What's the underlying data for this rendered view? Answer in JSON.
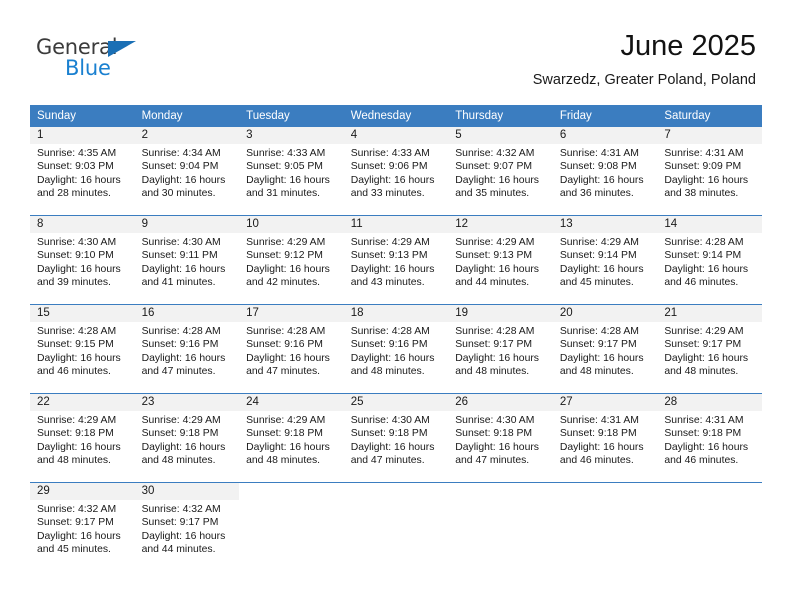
{
  "brand": {
    "name_top": "General",
    "name_bottom": "Blue",
    "triangle_icon": "blue-triangle-icon",
    "color_dark": "#3b3b3b",
    "color_blue": "#1a80d0"
  },
  "header": {
    "title": "June 2025",
    "subtitle": "Swarzedz, Greater Poland, Poland"
  },
  "theme": {
    "header_blue": "#3b7dc0",
    "daynum_bg": "#f2f2f2",
    "page_bg": "#ffffff"
  },
  "calendar": {
    "weekday_headers": [
      "Sunday",
      "Monday",
      "Tuesday",
      "Wednesday",
      "Thursday",
      "Friday",
      "Saturday"
    ],
    "weeks": [
      [
        {
          "day": "1",
          "lines": [
            "Sunrise: 4:35 AM",
            "Sunset: 9:03 PM",
            "Daylight: 16 hours",
            "and 28 minutes."
          ]
        },
        {
          "day": "2",
          "lines": [
            "Sunrise: 4:34 AM",
            "Sunset: 9:04 PM",
            "Daylight: 16 hours",
            "and 30 minutes."
          ]
        },
        {
          "day": "3",
          "lines": [
            "Sunrise: 4:33 AM",
            "Sunset: 9:05 PM",
            "Daylight: 16 hours",
            "and 31 minutes."
          ]
        },
        {
          "day": "4",
          "lines": [
            "Sunrise: 4:33 AM",
            "Sunset: 9:06 PM",
            "Daylight: 16 hours",
            "and 33 minutes."
          ]
        },
        {
          "day": "5",
          "lines": [
            "Sunrise: 4:32 AM",
            "Sunset: 9:07 PM",
            "Daylight: 16 hours",
            "and 35 minutes."
          ]
        },
        {
          "day": "6",
          "lines": [
            "Sunrise: 4:31 AM",
            "Sunset: 9:08 PM",
            "Daylight: 16 hours",
            "and 36 minutes."
          ]
        },
        {
          "day": "7",
          "lines": [
            "Sunrise: 4:31 AM",
            "Sunset: 9:09 PM",
            "Daylight: 16 hours",
            "and 38 minutes."
          ]
        }
      ],
      [
        {
          "day": "8",
          "lines": [
            "Sunrise: 4:30 AM",
            "Sunset: 9:10 PM",
            "Daylight: 16 hours",
            "and 39 minutes."
          ]
        },
        {
          "day": "9",
          "lines": [
            "Sunrise: 4:30 AM",
            "Sunset: 9:11 PM",
            "Daylight: 16 hours",
            "and 41 minutes."
          ]
        },
        {
          "day": "10",
          "lines": [
            "Sunrise: 4:29 AM",
            "Sunset: 9:12 PM",
            "Daylight: 16 hours",
            "and 42 minutes."
          ]
        },
        {
          "day": "11",
          "lines": [
            "Sunrise: 4:29 AM",
            "Sunset: 9:13 PM",
            "Daylight: 16 hours",
            "and 43 minutes."
          ]
        },
        {
          "day": "12",
          "lines": [
            "Sunrise: 4:29 AM",
            "Sunset: 9:13 PM",
            "Daylight: 16 hours",
            "and 44 minutes."
          ]
        },
        {
          "day": "13",
          "lines": [
            "Sunrise: 4:29 AM",
            "Sunset: 9:14 PM",
            "Daylight: 16 hours",
            "and 45 minutes."
          ]
        },
        {
          "day": "14",
          "lines": [
            "Sunrise: 4:28 AM",
            "Sunset: 9:14 PM",
            "Daylight: 16 hours",
            "and 46 minutes."
          ]
        }
      ],
      [
        {
          "day": "15",
          "lines": [
            "Sunrise: 4:28 AM",
            "Sunset: 9:15 PM",
            "Daylight: 16 hours",
            "and 46 minutes."
          ]
        },
        {
          "day": "16",
          "lines": [
            "Sunrise: 4:28 AM",
            "Sunset: 9:16 PM",
            "Daylight: 16 hours",
            "and 47 minutes."
          ]
        },
        {
          "day": "17",
          "lines": [
            "Sunrise: 4:28 AM",
            "Sunset: 9:16 PM",
            "Daylight: 16 hours",
            "and 47 minutes."
          ]
        },
        {
          "day": "18",
          "lines": [
            "Sunrise: 4:28 AM",
            "Sunset: 9:16 PM",
            "Daylight: 16 hours",
            "and 48 minutes."
          ]
        },
        {
          "day": "19",
          "lines": [
            "Sunrise: 4:28 AM",
            "Sunset: 9:17 PM",
            "Daylight: 16 hours",
            "and 48 minutes."
          ]
        },
        {
          "day": "20",
          "lines": [
            "Sunrise: 4:28 AM",
            "Sunset: 9:17 PM",
            "Daylight: 16 hours",
            "and 48 minutes."
          ]
        },
        {
          "day": "21",
          "lines": [
            "Sunrise: 4:29 AM",
            "Sunset: 9:17 PM",
            "Daylight: 16 hours",
            "and 48 minutes."
          ]
        }
      ],
      [
        {
          "day": "22",
          "lines": [
            "Sunrise: 4:29 AM",
            "Sunset: 9:18 PM",
            "Daylight: 16 hours",
            "and 48 minutes."
          ]
        },
        {
          "day": "23",
          "lines": [
            "Sunrise: 4:29 AM",
            "Sunset: 9:18 PM",
            "Daylight: 16 hours",
            "and 48 minutes."
          ]
        },
        {
          "day": "24",
          "lines": [
            "Sunrise: 4:29 AM",
            "Sunset: 9:18 PM",
            "Daylight: 16 hours",
            "and 48 minutes."
          ]
        },
        {
          "day": "25",
          "lines": [
            "Sunrise: 4:30 AM",
            "Sunset: 9:18 PM",
            "Daylight: 16 hours",
            "and 47 minutes."
          ]
        },
        {
          "day": "26",
          "lines": [
            "Sunrise: 4:30 AM",
            "Sunset: 9:18 PM",
            "Daylight: 16 hours",
            "and 47 minutes."
          ]
        },
        {
          "day": "27",
          "lines": [
            "Sunrise: 4:31 AM",
            "Sunset: 9:18 PM",
            "Daylight: 16 hours",
            "and 46 minutes."
          ]
        },
        {
          "day": "28",
          "lines": [
            "Sunrise: 4:31 AM",
            "Sunset: 9:18 PM",
            "Daylight: 16 hours",
            "and 46 minutes."
          ]
        }
      ],
      [
        {
          "day": "29",
          "lines": [
            "Sunrise: 4:32 AM",
            "Sunset: 9:17 PM",
            "Daylight: 16 hours",
            "and 45 minutes."
          ]
        },
        {
          "day": "30",
          "lines": [
            "Sunrise: 4:32 AM",
            "Sunset: 9:17 PM",
            "Daylight: 16 hours",
            "and 44 minutes."
          ]
        },
        {
          "day": "",
          "lines": []
        },
        {
          "day": "",
          "lines": []
        },
        {
          "day": "",
          "lines": []
        },
        {
          "day": "",
          "lines": []
        },
        {
          "day": "",
          "lines": []
        }
      ]
    ]
  }
}
